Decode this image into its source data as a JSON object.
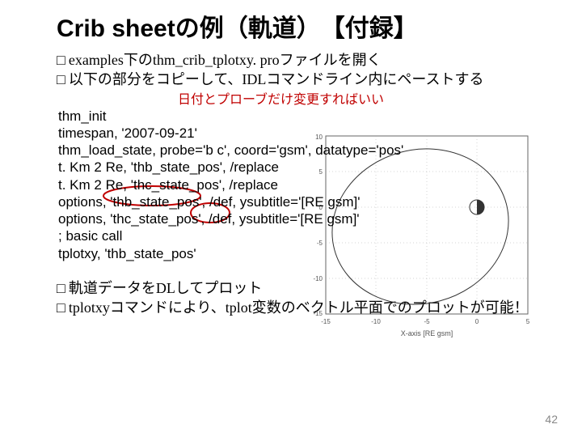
{
  "title": {
    "en": "Crib sheet",
    "jp": "の例（軌道）　【付録】"
  },
  "bullets_top": [
    "examples下のthm_crib_tplotxy. proファイルを開く",
    "以下の部分をコピーして、IDLコマンドライン内にペーストする"
  ],
  "note": "日付とプローブだけ変更すればいい",
  "code": [
    "thm_init",
    "timespan, '2007-09-21'",
    "thm_load_state, probe='b c', coord='gsm', datatype='pos'",
    "t. Km 2 Re, 'thb_state_pos', /replace",
    "t. Km 2 Re, 'thc_state_pos', /replace",
    "options, 'thb_state_pos', /def, ysubtitle='[RE gsm]'",
    "options, 'thc_state_pos', /def, ysubtitle='[RE gsm]'",
    "; basic call",
    "tplotxy, 'thb_state_pos'"
  ],
  "bullets_bottom": [
    "軌道データをDLしてプロット",
    "tplotxyコマンドにより、tplot変数のベクトル平面でのプロットが可能！"
  ],
  "page_number": "42",
  "plot": {
    "xlabel": "X-axis [RE gsm]",
    "ylabel": "",
    "xlim": [
      -15,
      5
    ],
    "ylim": [
      -15,
      10
    ],
    "xticks": [
      "-15",
      "-10",
      "-5",
      "0",
      "5"
    ],
    "yticks": [
      "-15",
      "-10",
      "-5",
      "0",
      "5",
      "10"
    ]
  }
}
